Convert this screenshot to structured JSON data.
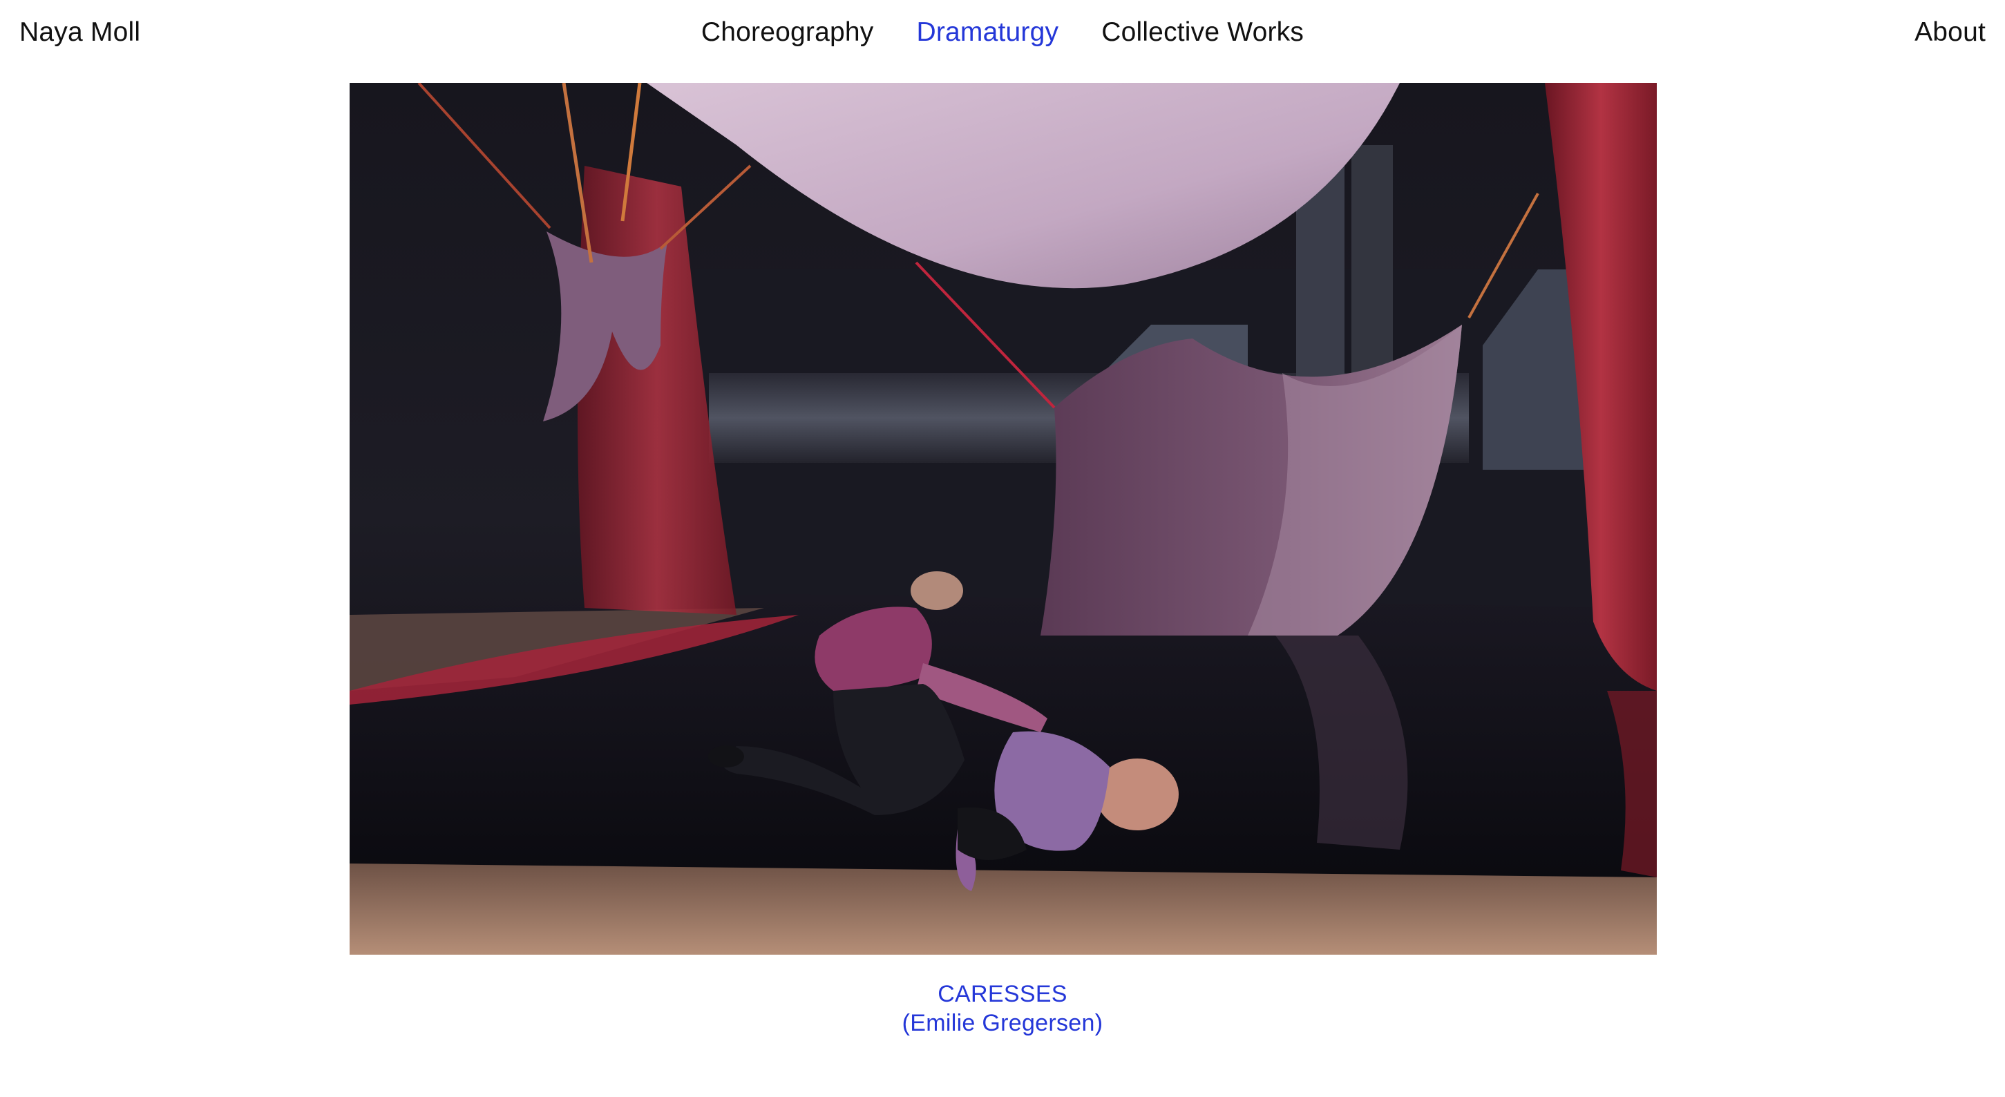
{
  "header": {
    "site_name": "Naya Moll",
    "nav": [
      {
        "label": "Choreography",
        "active": false
      },
      {
        "label": "Dramaturgy",
        "active": true
      },
      {
        "label": "Collective Works",
        "active": false
      }
    ],
    "about_label": "About"
  },
  "main": {
    "caption": {
      "title": "CARESSES",
      "credit": "(Emilie Gregersen)"
    }
  },
  "colors": {
    "accent": "#2437d8",
    "text": "#111111",
    "background": "#ffffff"
  }
}
